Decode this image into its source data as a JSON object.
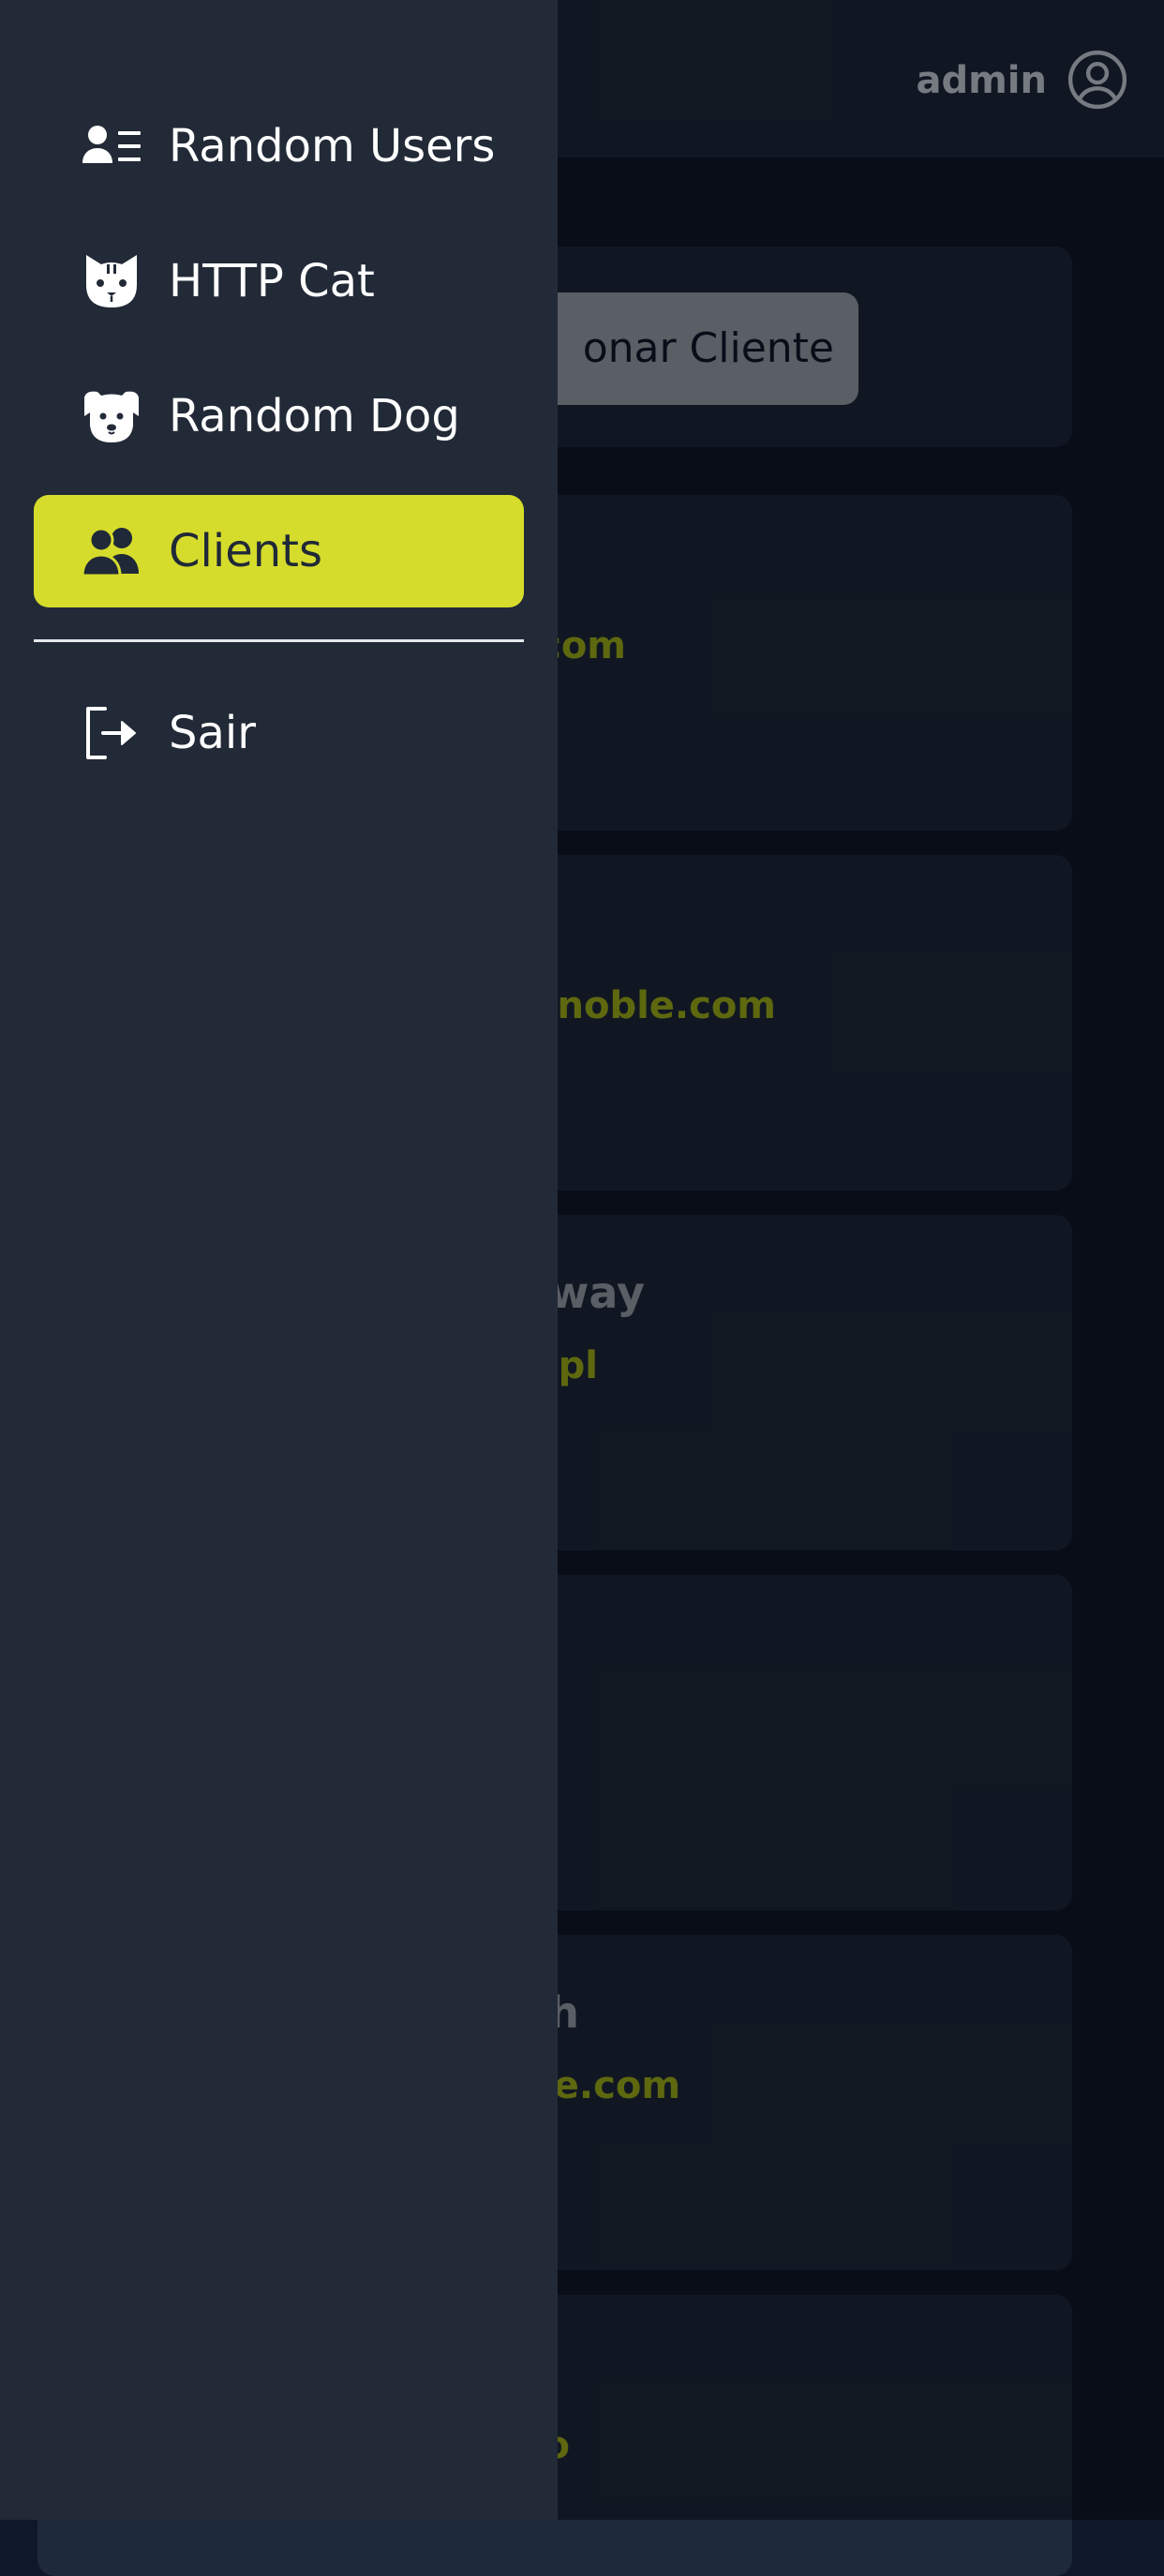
{
  "header": {
    "user_label": "admin",
    "user_icon": "user-circle-icon"
  },
  "main": {
    "add_client_button": "onar Cliente",
    "clients": [
      {
        "name": "",
        "email": ".com"
      },
      {
        "name": "",
        "email": "dnoble.com"
      },
      {
        "name": "way",
        "email": ".pl"
      },
      {
        "name": "",
        "email": ""
      },
      {
        "name": "h",
        "email": "re.com"
      },
      {
        "name": "",
        "email": "o"
      }
    ]
  },
  "sidebar": {
    "items": [
      {
        "label": "Random Users",
        "icon": "user-list-icon",
        "active": false
      },
      {
        "label": "HTTP Cat",
        "icon": "cat-icon",
        "active": false
      },
      {
        "label": "Random Dog",
        "icon": "dog-icon",
        "active": false
      },
      {
        "label": "Clients",
        "icon": "users-icon",
        "active": true
      }
    ],
    "logout": {
      "label": "Sair",
      "icon": "logout-icon"
    }
  },
  "colors": {
    "accent": "#d6dc2b",
    "drawer_bg": "#222a37",
    "page_bg": "#0f172a",
    "email": "#a3b31a"
  }
}
